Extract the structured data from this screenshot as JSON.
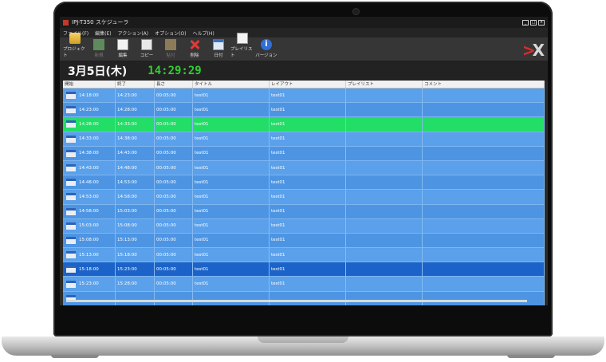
{
  "window": {
    "title": "IPJ-T350 スケジューラ"
  },
  "menu": [
    "ファイル(F)",
    "編集(E)",
    "アクション(A)",
    "オプション(O)",
    "ヘルプ(H)"
  ],
  "toolbar": [
    {
      "label": "プロジェクト",
      "icon": "folder-icon",
      "enabled": true
    },
    {
      "label": "新規",
      "icon": "new-icon",
      "enabled": false
    },
    {
      "label": "編集",
      "icon": "edit-icon",
      "enabled": true
    },
    {
      "label": "コピー",
      "icon": "copy-icon",
      "enabled": true
    },
    {
      "label": "貼付",
      "icon": "paste-icon",
      "enabled": false
    },
    {
      "label": "削除",
      "icon": "delete-icon",
      "enabled": true
    },
    {
      "label": "日付",
      "icon": "calendar-icon",
      "enabled": true
    },
    {
      "label": "プレイリスト",
      "icon": "playlist-icon",
      "enabled": true
    },
    {
      "label": "バージョン",
      "icon": "info-icon",
      "enabled": true
    }
  ],
  "datebar": {
    "date": "3月5日(木)",
    "time": "14:29:29"
  },
  "table": {
    "columns": [
      "開始",
      "終了",
      "長さ",
      "タイトル",
      "レイアウト",
      "プレイリスト",
      "コメント"
    ],
    "rows": [
      {
        "start": "14:18:00",
        "end": "14:23:00",
        "length": "00:05:00",
        "title": "test01",
        "layout": "test01",
        "playlist": "",
        "comment": "",
        "state": "normal"
      },
      {
        "start": "14:23:00",
        "end": "14:28:00",
        "length": "00:05:00",
        "title": "test01",
        "layout": "test01",
        "playlist": "",
        "comment": "",
        "state": "alt"
      },
      {
        "start": "14:28:00",
        "end": "14:33:00",
        "length": "00:05:00",
        "title": "test01",
        "layout": "test01",
        "playlist": "",
        "comment": "",
        "state": "active"
      },
      {
        "start": "14:33:00",
        "end": "14:38:00",
        "length": "00:05:00",
        "title": "test01",
        "layout": "test01",
        "playlist": "",
        "comment": "",
        "state": "normal"
      },
      {
        "start": "14:38:00",
        "end": "14:43:00",
        "length": "00:05:00",
        "title": "test01",
        "layout": "test01",
        "playlist": "",
        "comment": "",
        "state": "alt"
      },
      {
        "start": "14:43:00",
        "end": "14:48:00",
        "length": "00:05:00",
        "title": "test01",
        "layout": "test01",
        "playlist": "",
        "comment": "",
        "state": "normal"
      },
      {
        "start": "14:48:00",
        "end": "14:53:00",
        "length": "00:05:00",
        "title": "test01",
        "layout": "test01",
        "playlist": "",
        "comment": "",
        "state": "alt"
      },
      {
        "start": "14:53:00",
        "end": "14:58:00",
        "length": "00:05:00",
        "title": "test01",
        "layout": "test01",
        "playlist": "",
        "comment": "",
        "state": "normal"
      },
      {
        "start": "14:58:00",
        "end": "15:03:00",
        "length": "00:05:00",
        "title": "test01",
        "layout": "test01",
        "playlist": "",
        "comment": "",
        "state": "alt"
      },
      {
        "start": "15:03:00",
        "end": "15:08:00",
        "length": "00:05:00",
        "title": "test01",
        "layout": "test01",
        "playlist": "",
        "comment": "",
        "state": "normal"
      },
      {
        "start": "15:08:00",
        "end": "15:13:00",
        "length": "00:05:00",
        "title": "test01",
        "layout": "test01",
        "playlist": "",
        "comment": "",
        "state": "alt"
      },
      {
        "start": "15:13:00",
        "end": "15:18:00",
        "length": "00:05:00",
        "title": "test01",
        "layout": "test01",
        "playlist": "",
        "comment": "",
        "state": "normal"
      },
      {
        "start": "15:18:00",
        "end": "15:23:00",
        "length": "00:05:00",
        "title": "test01",
        "layout": "test01",
        "playlist": "",
        "comment": "",
        "state": "selected"
      },
      {
        "start": "15:23:00",
        "end": "15:28:00",
        "length": "00:05:00",
        "title": "test01",
        "layout": "test01",
        "playlist": "",
        "comment": "",
        "state": "normal"
      },
      {
        "start": "",
        "end": "",
        "length": "",
        "title": "",
        "layout": "",
        "playlist": "",
        "comment": "",
        "state": "alt"
      }
    ]
  },
  "colors": {
    "row": "#5aa0ea",
    "active": "#22dd66",
    "selected": "#1b63c8",
    "clock": "#33cc33"
  }
}
